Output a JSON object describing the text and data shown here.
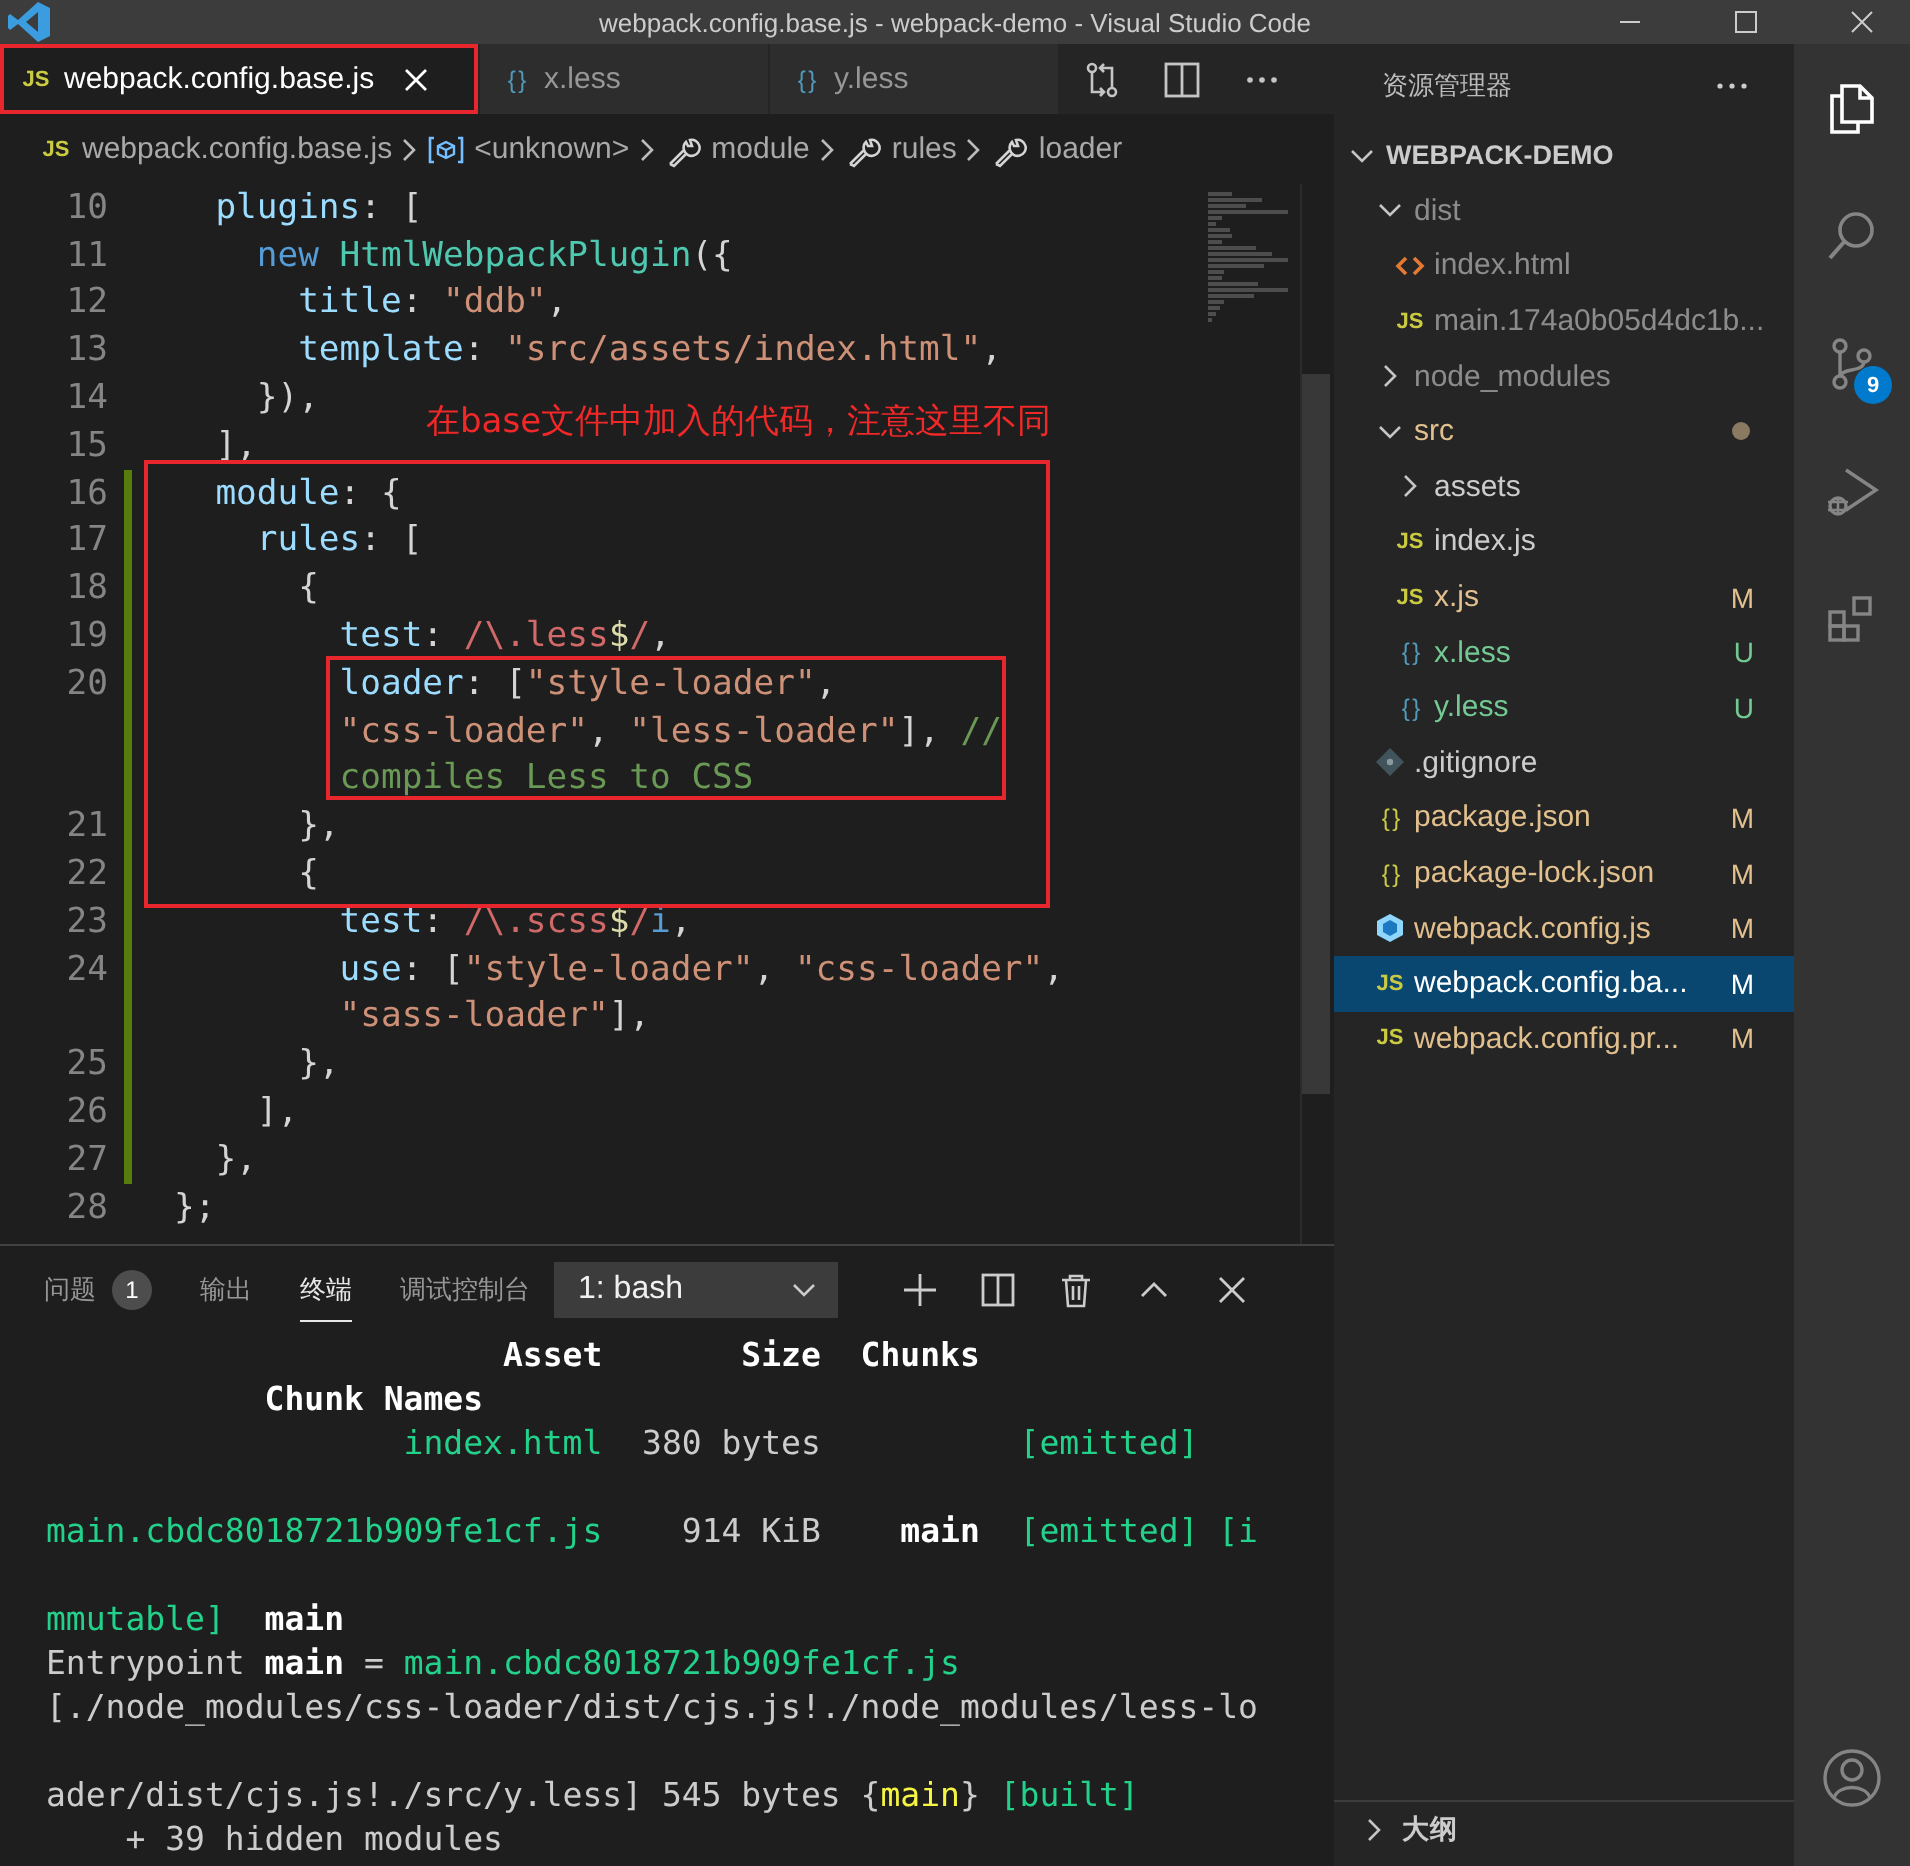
{
  "window": {
    "title": "webpack.config.base.js - webpack-demo - Visual Studio Code"
  },
  "tabs": [
    {
      "kind": "js",
      "icon_text": "JS",
      "label": "webpack.config.base.js",
      "selected": true,
      "outlined": true
    },
    {
      "kind": "less",
      "icon_text": "{ }",
      "label": "x.less",
      "selected": false,
      "outlined": false
    },
    {
      "kind": "less",
      "icon_text": "{ }",
      "label": "y.less",
      "selected": false,
      "outlined": false
    }
  ],
  "breadcrumb": [
    {
      "kind": "js",
      "icon_text": "JS",
      "label": "webpack.config.base.js"
    },
    {
      "kind": "object",
      "label": "<unknown>"
    },
    {
      "kind": "property",
      "label": "module"
    },
    {
      "kind": "property",
      "label": "rules"
    },
    {
      "kind": "property",
      "label": "loader"
    }
  ],
  "editor": {
    "annotation": "在base文件中加入的代码，注意这里不同",
    "rows": [
      {
        "kind": "line",
        "number": "10",
        "changed": false,
        "tokens": [
          {
            "text": "  plugins",
            "kind": "prop"
          },
          {
            "text": ": [",
            "kind": "plain"
          }
        ]
      },
      {
        "kind": "line",
        "number": "11",
        "changed": false,
        "tokens": [
          {
            "text": "    new",
            "kind": "keyword"
          },
          {
            "text": " HtmlWebpackPlugin",
            "kind": "class"
          },
          {
            "text": "({",
            "kind": "plain"
          }
        ]
      },
      {
        "kind": "line",
        "number": "12",
        "changed": false,
        "tokens": [
          {
            "text": "      title",
            "kind": "prop"
          },
          {
            "text": ": ",
            "kind": "plain"
          },
          {
            "text": "\"ddb\"",
            "kind": "string"
          },
          {
            "text": ",",
            "kind": "plain"
          }
        ]
      },
      {
        "kind": "line",
        "number": "13",
        "changed": false,
        "tokens": [
          {
            "text": "      template",
            "kind": "prop"
          },
          {
            "text": ": ",
            "kind": "plain"
          },
          {
            "text": "\"src/assets/index.html\"",
            "kind": "string"
          },
          {
            "text": ",",
            "kind": "plain"
          }
        ]
      },
      {
        "kind": "line",
        "number": "14",
        "changed": false,
        "tokens": [
          {
            "text": "    }),",
            "kind": "plain"
          }
        ]
      },
      {
        "kind": "line",
        "number": "15",
        "changed": false,
        "tokens": [
          {
            "text": "  ],",
            "kind": "plain"
          }
        ]
      },
      {
        "kind": "line",
        "number": "16",
        "changed": true,
        "tokens": [
          {
            "text": "  module",
            "kind": "prop"
          },
          {
            "text": ": {",
            "kind": "plain"
          }
        ]
      },
      {
        "kind": "line",
        "number": "17",
        "changed": true,
        "tokens": [
          {
            "text": "    rules",
            "kind": "prop"
          },
          {
            "text": ": [",
            "kind": "plain"
          }
        ]
      },
      {
        "kind": "line",
        "number": "18",
        "changed": true,
        "tokens": [
          {
            "text": "      {",
            "kind": "plain"
          }
        ]
      },
      {
        "kind": "line",
        "number": "19",
        "changed": true,
        "tokens": [
          {
            "text": "        test",
            "kind": "prop"
          },
          {
            "text": ": ",
            "kind": "plain"
          },
          {
            "text": "/\\.less",
            "kind": "regex"
          },
          {
            "text": "$",
            "kind": "regex-op"
          },
          {
            "text": "/",
            "kind": "regex"
          },
          {
            "text": ",",
            "kind": "plain"
          }
        ]
      },
      {
        "kind": "line",
        "number": "20",
        "changed": true,
        "tokens": [
          {
            "text": "        loader",
            "kind": "prop"
          },
          {
            "text": ": [",
            "kind": "plain"
          },
          {
            "text": "\"style-loader\"",
            "kind": "string"
          },
          {
            "text": ",",
            "kind": "plain"
          }
        ]
      },
      {
        "kind": "wrap",
        "changed": true,
        "tokens": [
          {
            "text": "        \"css-loader\"",
            "kind": "string"
          },
          {
            "text": ", ",
            "kind": "plain"
          },
          {
            "text": "\"less-loader\"",
            "kind": "string"
          },
          {
            "text": "], ",
            "kind": "plain"
          },
          {
            "text": "//",
            "kind": "comment"
          }
        ]
      },
      {
        "kind": "wrap",
        "changed": true,
        "tokens": [
          {
            "text": "        compiles Less to CSS",
            "kind": "comment"
          }
        ]
      },
      {
        "kind": "line",
        "number": "21",
        "changed": true,
        "tokens": [
          {
            "text": "      },",
            "kind": "plain"
          }
        ]
      },
      {
        "kind": "line",
        "number": "22",
        "changed": true,
        "tokens": [
          {
            "text": "      {",
            "kind": "plain"
          }
        ]
      },
      {
        "kind": "line",
        "number": "23",
        "changed": true,
        "tokens": [
          {
            "text": "        test",
            "kind": "prop"
          },
          {
            "text": ": ",
            "kind": "plain"
          },
          {
            "text": "/\\.scss",
            "kind": "regex"
          },
          {
            "text": "$",
            "kind": "regex-op"
          },
          {
            "text": "/",
            "kind": "regex"
          },
          {
            "text": "i",
            "kind": "keyword"
          },
          {
            "text": ",",
            "kind": "plain"
          }
        ]
      },
      {
        "kind": "line",
        "number": "24",
        "changed": true,
        "tokens": [
          {
            "text": "        use",
            "kind": "prop"
          },
          {
            "text": ": [",
            "kind": "plain"
          },
          {
            "text": "\"style-loader\"",
            "kind": "string"
          },
          {
            "text": ", ",
            "kind": "plain"
          },
          {
            "text": "\"css-loader\"",
            "kind": "string"
          },
          {
            "text": ",",
            "kind": "plain"
          }
        ]
      },
      {
        "kind": "wrap",
        "changed": true,
        "tokens": [
          {
            "text": "        \"sass-loader\"",
            "kind": "string"
          },
          {
            "text": "],",
            "kind": "plain"
          }
        ]
      },
      {
        "kind": "line",
        "number": "25",
        "changed": true,
        "tokens": [
          {
            "text": "      },",
            "kind": "plain"
          }
        ]
      },
      {
        "kind": "line",
        "number": "26",
        "changed": true,
        "tokens": [
          {
            "text": "    ],",
            "kind": "plain"
          }
        ]
      },
      {
        "kind": "line",
        "number": "27",
        "changed": true,
        "tokens": [
          {
            "text": "  },",
            "kind": "plain"
          }
        ]
      },
      {
        "kind": "line",
        "number": "28",
        "changed": false,
        "tokens": [
          {
            "text": "};",
            "kind": "plain"
          }
        ]
      }
    ]
  },
  "panel": {
    "tabs": [
      {
        "label": "问题",
        "badge": "1",
        "selected": false
      },
      {
        "label": "输出",
        "selected": false
      },
      {
        "label": "终端",
        "selected": true
      },
      {
        "label": "调试控制台",
        "selected": false
      }
    ],
    "terminal_select": {
      "value": "1: bash"
    },
    "terminal": [
      {
        "kind": "text",
        "tokens": [
          {
            "text": "                       Asset       Size  Chunks",
            "kind": "bold"
          }
        ]
      },
      {
        "kind": "text",
        "tokens": [
          {
            "text": "           Chunk Names",
            "kind": "bold"
          }
        ]
      },
      {
        "kind": "text",
        "tokens": [
          {
            "text": "                  index.html",
            "kind": "green"
          },
          {
            "text": "  380 bytes          ",
            "kind": "plain"
          },
          {
            "text": "[emitted]",
            "kind": "green"
          }
        ]
      },
      {
        "kind": "blank"
      },
      {
        "kind": "text",
        "tokens": [
          {
            "text": "main.cbdc8018721b909fe1cf.js",
            "kind": "green"
          },
          {
            "text": "    914 KiB    ",
            "kind": "plain"
          },
          {
            "text": "main",
            "kind": "bold"
          },
          {
            "text": "  [emitted] [i",
            "kind": "green"
          }
        ]
      },
      {
        "kind": "blank"
      },
      {
        "kind": "text",
        "tokens": [
          {
            "text": "mmutable]",
            "kind": "green"
          },
          {
            "text": "  main",
            "kind": "bold"
          }
        ]
      },
      {
        "kind": "text",
        "tokens": [
          {
            "text": "Entrypoint ",
            "kind": "plain"
          },
          {
            "text": "main",
            "kind": "bold"
          },
          {
            "text": " = ",
            "kind": "plain"
          },
          {
            "text": "main.cbdc8018721b909fe1cf.js",
            "kind": "green"
          }
        ]
      },
      {
        "kind": "text",
        "tokens": [
          {
            "text": "[./node_modules/css-loader/dist/cjs.js!./node_modules/less-lo",
            "kind": "plain"
          }
        ]
      },
      {
        "kind": "blank"
      },
      {
        "kind": "text",
        "tokens": [
          {
            "text": "ader/dist/cjs.js!./src/y.less] 545 bytes {",
            "kind": "plain"
          },
          {
            "text": "main",
            "kind": "yellow"
          },
          {
            "text": "} ",
            "kind": "plain"
          },
          {
            "text": "[built]",
            "kind": "green"
          }
        ]
      },
      {
        "kind": "text",
        "tokens": [
          {
            "text": "    + 39 hidden modules",
            "kind": "plain"
          }
        ]
      }
    ]
  },
  "explorer": {
    "title": "资源管理器",
    "root": {
      "label": "WEBPACK-DEMO",
      "expanded": true
    },
    "items": [
      {
        "kind": "folder",
        "label": "dist",
        "expanded": true,
        "color": "#8c8c8c",
        "changed": false,
        "selected": false,
        "children": [
          {
            "kind": "html",
            "label": "index.html",
            "color": "#8c8c8c",
            "selected": false
          },
          {
            "kind": "js",
            "icon_text": "JS",
            "label": "main.174a0b05d4dc1b...",
            "color": "#8c8c8c",
            "selected": false
          }
        ]
      },
      {
        "kind": "folder",
        "label": "node_modules",
        "expanded": false,
        "color": "#8c8c8c",
        "changed": false,
        "selected": false
      },
      {
        "kind": "folder",
        "label": "src",
        "expanded": true,
        "color": "#e2c08d",
        "changed": true,
        "selected": false,
        "children": [
          {
            "kind": "folder",
            "label": "assets",
            "expanded": false,
            "color": "#cccccc",
            "changed": false,
            "selected": false
          },
          {
            "kind": "js",
            "icon_text": "JS",
            "label": "index.js",
            "color": "#cccccc",
            "selected": false
          },
          {
            "kind": "js",
            "icon_text": "JS",
            "label": "x.js",
            "color": "#e2c08d",
            "status": "M",
            "selected": false
          },
          {
            "kind": "less",
            "icon_text": "{ }",
            "label": "x.less",
            "color": "#73c991",
            "status": "U",
            "selected": false
          },
          {
            "kind": "less",
            "icon_text": "{ }",
            "label": "y.less",
            "color": "#73c991",
            "status": "U",
            "selected": false
          }
        ]
      },
      {
        "kind": "git",
        "label": ".gitignore",
        "color": "#cccccc",
        "selected": false
      },
      {
        "kind": "json",
        "icon_text": "{ }",
        "label": "package.json",
        "color": "#e2c08d",
        "status": "M",
        "selected": false
      },
      {
        "kind": "json",
        "icon_text": "{ }",
        "label": "package-lock.json",
        "color": "#e2c08d",
        "status": "M",
        "selected": false
      },
      {
        "kind": "webpack",
        "label": "webpack.config.js",
        "color": "#e2c08d",
        "status": "M",
        "selected": false
      },
      {
        "kind": "js",
        "icon_text": "JS",
        "label": "webpack.config.ba...",
        "color": "#ffffff",
        "status": "M",
        "selected": true
      },
      {
        "kind": "js",
        "icon_text": "JS",
        "label": "webpack.config.pr...",
        "color": "#e2c08d",
        "status": "M",
        "selected": false
      }
    ],
    "outline": {
      "label": "大纲",
      "expanded": false
    }
  },
  "activity_bar": [
    {
      "kind": "files",
      "selected": true
    },
    {
      "kind": "search",
      "selected": false
    },
    {
      "kind": "source-control",
      "badge": "9",
      "selected": false
    },
    {
      "kind": "run",
      "selected": false
    },
    {
      "kind": "extensions",
      "selected": false
    }
  ]
}
